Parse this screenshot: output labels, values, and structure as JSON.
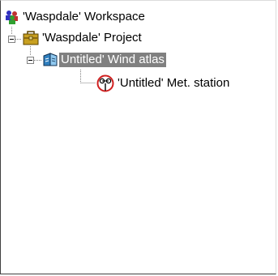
{
  "tree": {
    "workspace": {
      "label": "'Waspdale' Workspace",
      "icon": "workspace-users-icon"
    },
    "project": {
      "label": "'Waspdale' Project",
      "icon": "project-briefcase-icon"
    },
    "wind_atlas": {
      "label": "Untitled' Wind atlas",
      "icon": "wind-atlas-book-icon",
      "selected": true
    },
    "met_station": {
      "label": "'Untitled' Met. station",
      "icon": "met-station-anemometer-icon"
    }
  },
  "colors": {
    "selection_bg": "#808080",
    "selection_fg": "#ffffff",
    "tree_lines": "#808080"
  }
}
